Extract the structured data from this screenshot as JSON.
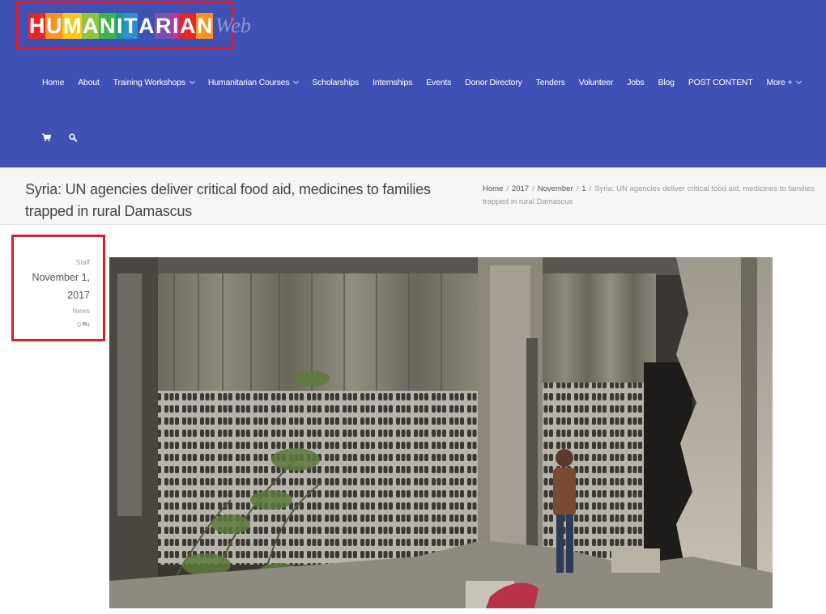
{
  "colors": {
    "header_bg": "#3f51b5",
    "highlight_red": "#e31b23",
    "logo_letter_colors": [
      "#e4262b",
      "#f7931e",
      "#f7c71a",
      "#8dc63f",
      "#39b54a",
      "#1b9a8a",
      "#2e8fd0",
      "#3f51b5",
      "#7c4fb3",
      "#c2339a",
      "#e4262b",
      "#f7931e"
    ]
  },
  "logo": {
    "letters": [
      "H",
      "U",
      "M",
      "A",
      "N",
      "I",
      "T",
      "A",
      "R",
      "I",
      "A",
      "N"
    ],
    "suffix": "Web"
  },
  "nav": {
    "items": [
      {
        "label": "Home",
        "dropdown": false
      },
      {
        "label": "About",
        "dropdown": false
      },
      {
        "label": "Training Workshops",
        "dropdown": true
      },
      {
        "label": "Humanitarian Courses",
        "dropdown": true
      },
      {
        "label": "Scholarships",
        "dropdown": false
      },
      {
        "label": "Internships",
        "dropdown": false
      },
      {
        "label": "Events",
        "dropdown": false
      },
      {
        "label": "Donor Directory",
        "dropdown": false
      },
      {
        "label": "Tenders",
        "dropdown": false
      },
      {
        "label": "Volunteer",
        "dropdown": false
      },
      {
        "label": "Jobs",
        "dropdown": false
      },
      {
        "label": "Blog",
        "dropdown": false
      },
      {
        "label": "POST CONTENT",
        "dropdown": false
      },
      {
        "label": "More +",
        "dropdown": true
      }
    ],
    "icons": [
      "cart-icon",
      "search-icon"
    ]
  },
  "page": {
    "title": "Syria: UN agencies deliver critical food aid, medicines to families trapped in rural Damascus"
  },
  "breadcrumb": {
    "items": [
      "Home",
      "2017",
      "November",
      "1"
    ],
    "current": "Syria: UN agencies deliver critical food aid, medicines to families trapped in rural Damascus"
  },
  "meta": {
    "author": "Staff",
    "date": "November 1, 2017",
    "category": "News",
    "comments": "0"
  }
}
